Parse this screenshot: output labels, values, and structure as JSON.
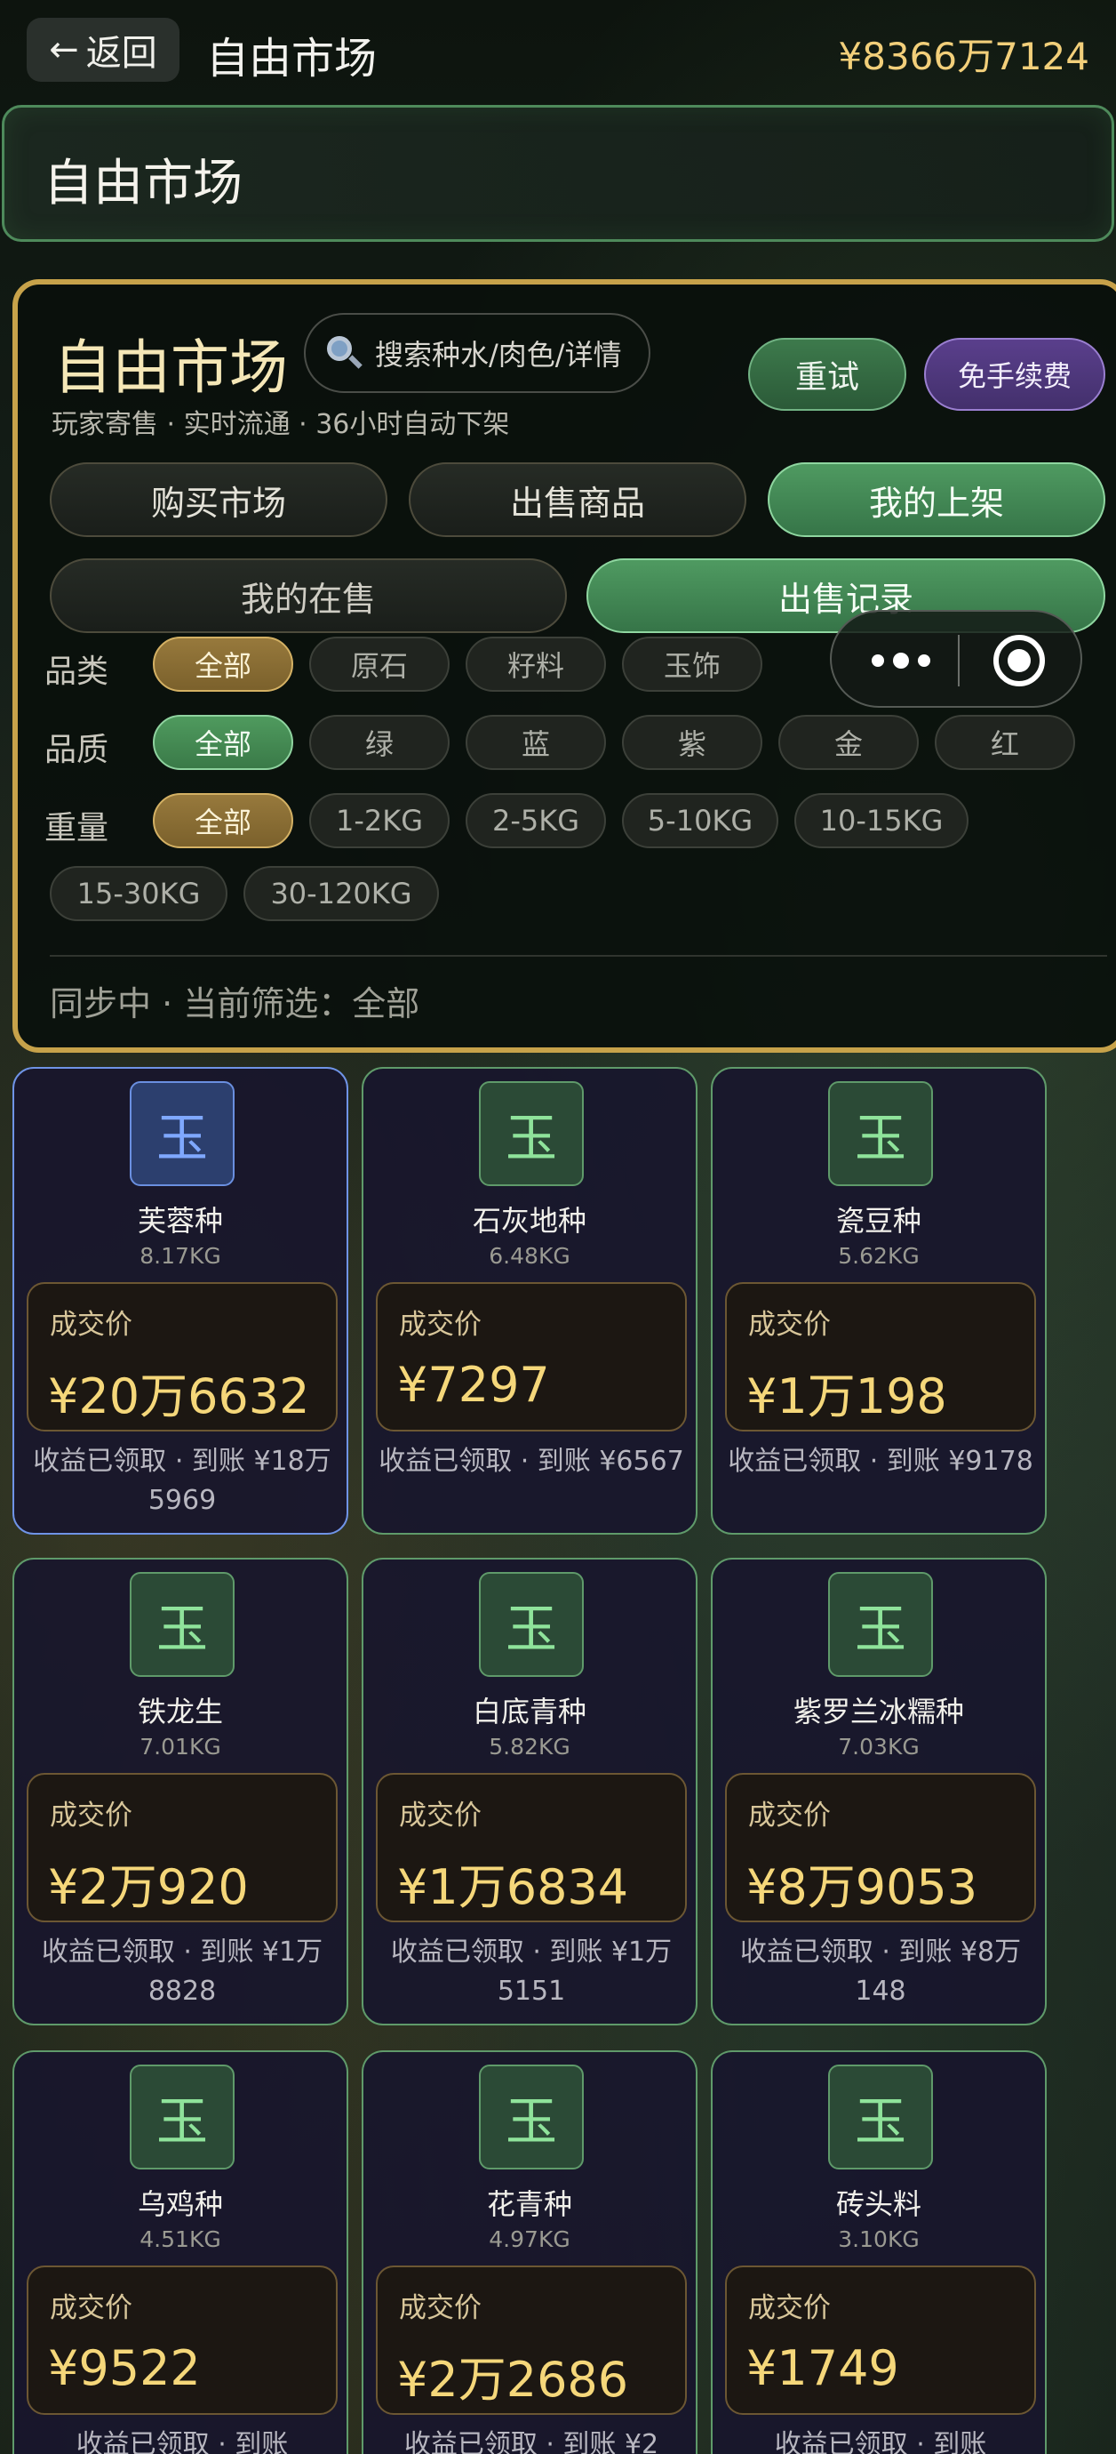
{
  "topbar": {
    "back_arrow": "←",
    "back_label": "返回",
    "title": "自由市场",
    "balance": "¥8366万7124"
  },
  "banner": {
    "title": "自由市场"
  },
  "panel": {
    "title": "自由市场",
    "search_placeholder": "搜索种水/肉色/详情",
    "retry_label": "重试",
    "free_fee_label": "免手续费",
    "subtitle": "玩家寄售 · 实时流通 · 36小时自动下架",
    "tabs": {
      "buy": "购买市场",
      "sell": "出售商品",
      "my_listings": "我的上架",
      "on_sale": "我的在售",
      "records": "出售记录"
    },
    "filters": {
      "category_label": "品类",
      "category_options": [
        "全部",
        "原石",
        "籽料",
        "玉饰"
      ],
      "quality_label": "品质",
      "quality_options": [
        "全部",
        "绿",
        "蓝",
        "紫",
        "金",
        "红"
      ],
      "weight_label": "重量",
      "weight_options": [
        "全部",
        "1-2KG",
        "2-5KG",
        "5-10KG",
        "10-15KG",
        "15-30KG",
        "30-120KG"
      ]
    },
    "sync_status": "同步中 · 当前筛选：全部"
  },
  "price_label": "成交价",
  "jade_char": "玉",
  "cards": [
    {
      "name": "芙蓉种",
      "weight": "8.17KG",
      "price": "¥20万6632",
      "status": "收益已领取 · 到账 ¥18万5969"
    },
    {
      "name": "石灰地种",
      "weight": "6.48KG",
      "price": "¥7297",
      "status": "收益已领取 · 到账 ¥6567"
    },
    {
      "name": "瓷豆种",
      "weight": "5.62KG",
      "price": "¥1万198",
      "status": "收益已领取 · 到账 ¥9178"
    },
    {
      "name": "铁龙生",
      "weight": "7.01KG",
      "price": "¥2万920",
      "status": "收益已领取 · 到账 ¥1万8828"
    },
    {
      "name": "白底青种",
      "weight": "5.82KG",
      "price": "¥1万6834",
      "status": "收益已领取 · 到账 ¥1万5151"
    },
    {
      "name": "紫罗兰冰糯种",
      "weight": "7.03KG",
      "price": "¥8万9053",
      "status": "收益已领取 · 到账 ¥8万148"
    },
    {
      "name": "乌鸡种",
      "weight": "4.51KG",
      "price": "¥9522",
      "status": "收益已领取 · 到账"
    },
    {
      "name": "花青种",
      "weight": "4.97KG",
      "price": "¥2万2686",
      "status": "收益已领取 · 到账 ¥2"
    },
    {
      "name": "砖头料",
      "weight": "3.10KG",
      "price": "¥1749",
      "status": "收益已领取 · 到账"
    }
  ]
}
